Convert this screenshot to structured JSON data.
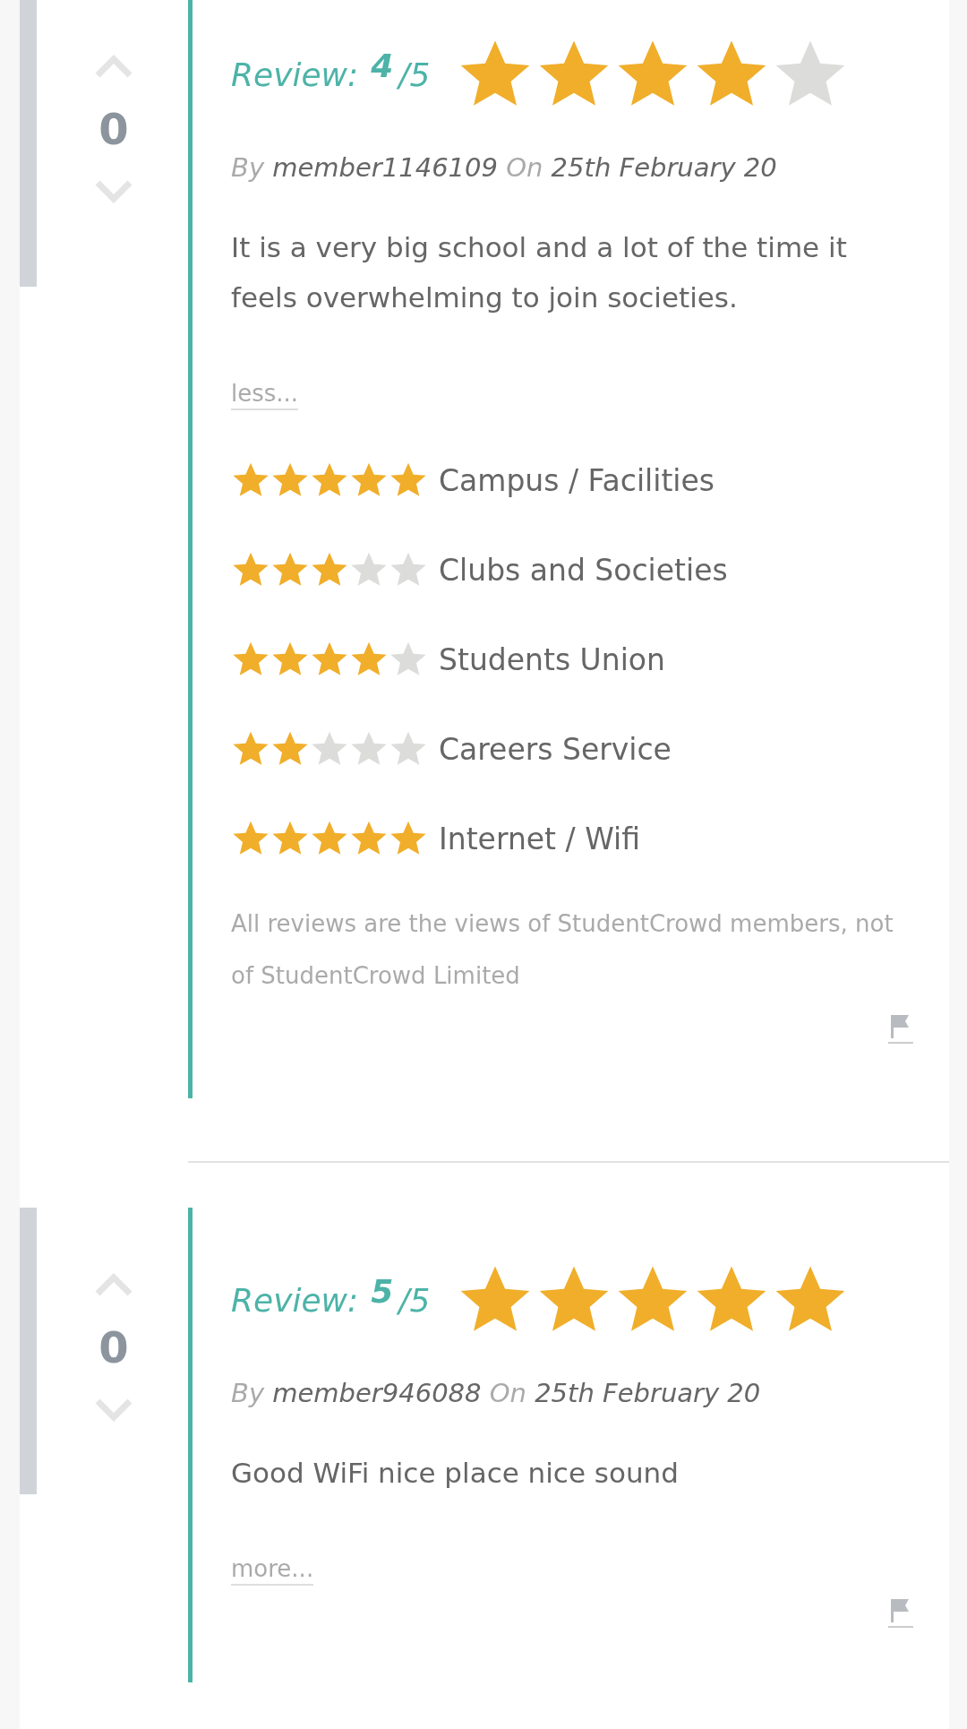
{
  "reviews": [
    {
      "votes": "0",
      "review_label": "Review:",
      "score": "4",
      "out_of": "/5",
      "stars": 4,
      "by_label": "By",
      "member": "member1146109",
      "on_label": "On",
      "date": "25th February 20",
      "body": "It is a very big school and a lot of the time it feels overwhelming to join societies.",
      "toggle": "less...",
      "categories": [
        {
          "label": "Campus / Facilities",
          "stars": 5
        },
        {
          "label": "Clubs and Societies",
          "stars": 3
        },
        {
          "label": "Students Union",
          "stars": 4
        },
        {
          "label": "Careers Service",
          "stars": 2
        },
        {
          "label": "Internet / Wifi",
          "stars": 5
        }
      ],
      "disclaimer": "All reviews are the views of StudentCrowd members, not of StudentCrowd Limited"
    },
    {
      "votes": "0",
      "review_label": "Review:",
      "score": "5",
      "out_of": "/5",
      "stars": 5,
      "by_label": "By",
      "member": "member946088",
      "on_label": "On",
      "date": "25th February 20",
      "body": "Good WiFi nice place nice sound",
      "toggle": "more..."
    }
  ]
}
